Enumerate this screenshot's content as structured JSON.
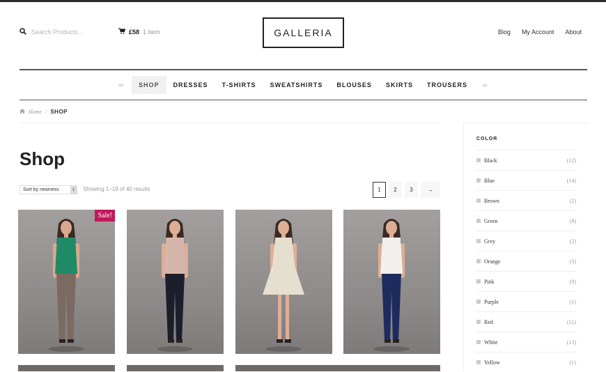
{
  "header": {
    "search_placeholder": "Search Products...",
    "cart_total": "£58",
    "cart_count": "1 item",
    "logo": "GALLERIA",
    "links": [
      "Blog",
      "My Account",
      "About"
    ]
  },
  "nav": {
    "items": [
      "SHOP",
      "DRESSES",
      "T-SHIRTS",
      "SWEATSHIRTS",
      "BLOUSES",
      "SKIRTS",
      "TROUSERS"
    ],
    "active": "SHOP"
  },
  "breadcrumb": {
    "home": "Home",
    "sep": "/",
    "current": "SHOP"
  },
  "page_title": "Shop",
  "toolbar": {
    "sort_value": "Sort by newness",
    "result_count": "Showing 1–19 of 40 results"
  },
  "pagination": {
    "pages": [
      "1",
      "2",
      "3"
    ],
    "next": "→"
  },
  "products": [
    {
      "sale_badge": "Sale!",
      "top": "#1f8a66",
      "bottom": "#7b6a61",
      "skin": "#d8a98e"
    },
    {
      "sale_badge": "",
      "top": "#d6b5ab",
      "bottom": "#1c1f2b",
      "skin": "#dcae94"
    },
    {
      "sale_badge": "",
      "top": "#e5dfd0",
      "bottom": "#e5dfd0",
      "skin": "#ddb096"
    },
    {
      "sale_badge": "",
      "top": "#f2f0ee",
      "bottom": "#1e2b5e",
      "skin": "#dcae94"
    }
  ],
  "sidebar": {
    "title": "COLOR",
    "colors": [
      {
        "name": "Black",
        "count": "(12)"
      },
      {
        "name": "Blue",
        "count": "(14)"
      },
      {
        "name": "Brown",
        "count": "(2)"
      },
      {
        "name": "Green",
        "count": "(8)"
      },
      {
        "name": "Grey",
        "count": "(2)"
      },
      {
        "name": "Orange",
        "count": "(5)"
      },
      {
        "name": "Pink",
        "count": "(9)"
      },
      {
        "name": "Purple",
        "count": "(1)"
      },
      {
        "name": "Red",
        "count": "(11)"
      },
      {
        "name": "White",
        "count": "(13)"
      },
      {
        "name": "Yellow",
        "count": "(1)"
      }
    ]
  }
}
